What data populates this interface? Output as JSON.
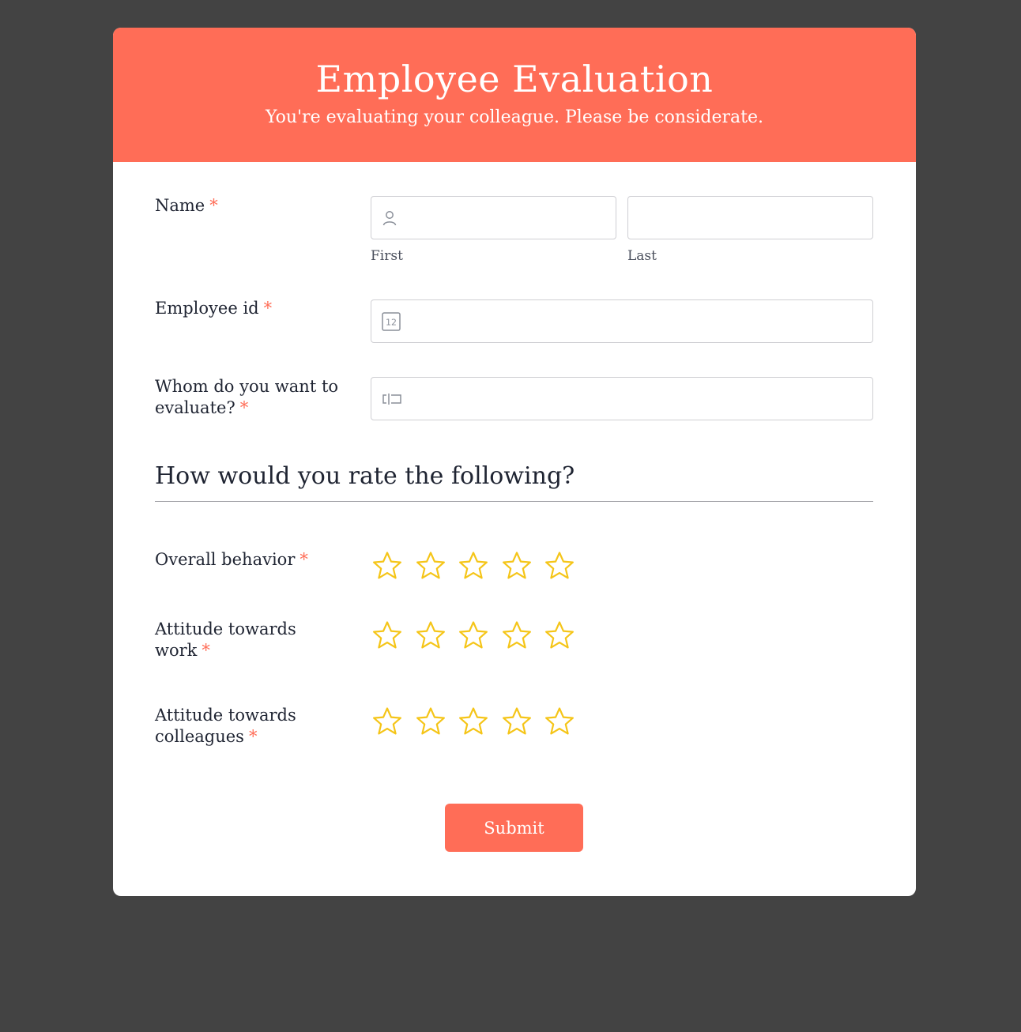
{
  "form": {
    "title": "Employee Evaluation",
    "subtitle": "You're evaluating your colleague. Please be considerate.",
    "accent_color": "#ff6d57",
    "star_color": "#f5c518",
    "required_mark": "*"
  },
  "fields": {
    "name": {
      "label": "Name",
      "first_sublabel": "First",
      "last_sublabel": "Last",
      "first_value": "",
      "last_value": "",
      "first_icon": "user-icon"
    },
    "employee_id": {
      "label": "Employee id",
      "value": "",
      "icon": "number-icon"
    },
    "evaluatee": {
      "label_line1": "Whom do you want to",
      "label_line2": "evaluate?",
      "value": "",
      "icon": "text-input-icon"
    }
  },
  "rating_section": {
    "heading": "How would you rate the following?",
    "max_stars": 5,
    "items": [
      {
        "label_line1": "Overall behavior",
        "label_line2": "",
        "rating": 0
      },
      {
        "label_line1": "Attitude towards",
        "label_line2": "work",
        "rating": 0
      },
      {
        "label_line1": "Attitude towards",
        "label_line2": "colleagues",
        "rating": 0
      }
    ]
  },
  "submit_label": "Submit"
}
